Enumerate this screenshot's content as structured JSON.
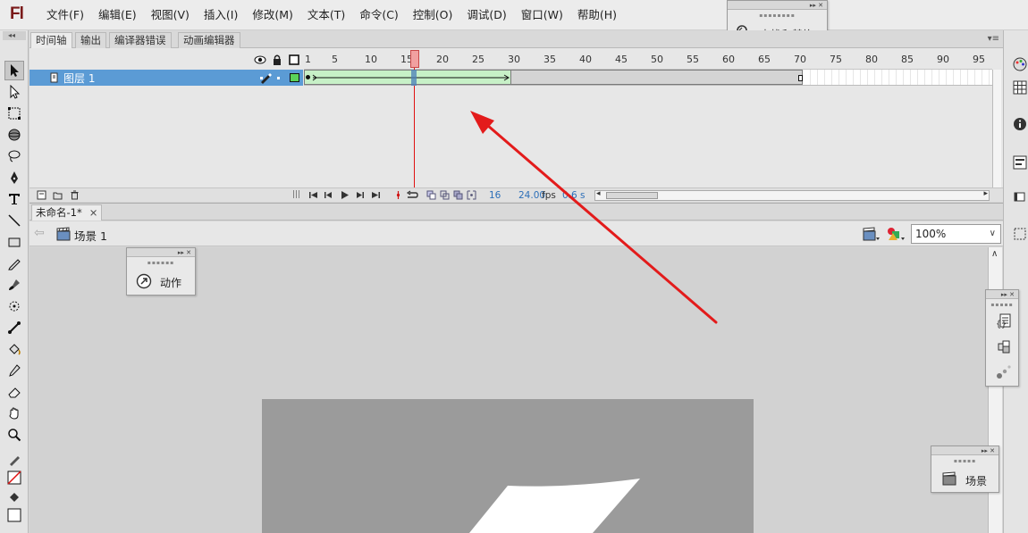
{
  "app": {
    "logo": "Fl",
    "menu": [
      "文件(F)",
      "编辑(E)",
      "视图(V)",
      "插入(I)",
      "修改(M)",
      "文本(T)",
      "命令(C)",
      "控制(O)",
      "调试(D)",
      "窗口(W)",
      "帮助(H)"
    ]
  },
  "timeline_panel": {
    "tabs": [
      "时间轴",
      "输出",
      "编译器错误",
      "动画编辑器"
    ],
    "active_tab": "时间轴",
    "ruler_labels": [
      "1",
      "5",
      "10",
      "15",
      "20",
      "25",
      "30",
      "35",
      "40",
      "45",
      "50",
      "55",
      "60",
      "65",
      "70",
      "75",
      "80",
      "85",
      "90",
      "95"
    ],
    "layer_name": "图层 1",
    "current_frame": "16",
    "fps": "24.00",
    "fps_unit": "fps",
    "elapsed": "0.6 s"
  },
  "document": {
    "tab_title": "未命名-1*",
    "tab_close": "×",
    "scene_label": "场景 1",
    "zoom": "100%"
  },
  "floating_panels": {
    "find_replace": "查找和替换",
    "actions": "动作",
    "scene": "场景"
  },
  "colors": {
    "layer_selected": "#5b9bd5",
    "tween_fill": "#c7f0c7",
    "playhead": "#e01010",
    "annotation_arrow": "#e31b1b"
  }
}
